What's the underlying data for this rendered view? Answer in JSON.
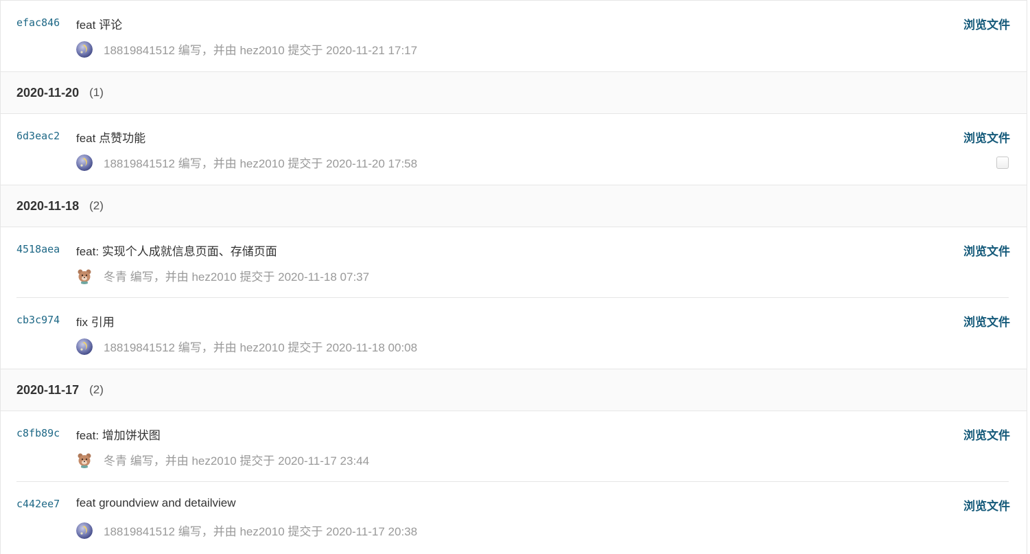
{
  "browse_label": "浏览文件",
  "top_commit": {
    "sha": "efac846",
    "message": "feat 评论",
    "author": "18819841512",
    "meta": "18819841512 编写，并由 hez2010 提交于 2020-11-21 17:17",
    "avatar": "moon-avatar"
  },
  "groups": [
    {
      "date": "2020-11-20",
      "count": "(1)",
      "commits": [
        {
          "sha": "6d3eac2",
          "message": "feat 点赞功能",
          "meta": "18819841512 编写，并由 hez2010 提交于 2020-11-20 17:58",
          "avatar": "moon-avatar",
          "has_checkbox": true
        }
      ]
    },
    {
      "date": "2020-11-18",
      "count": "(2)",
      "commits": [
        {
          "sha": "4518aea",
          "message": "feat: 实现个人成就信息页面、存储页面",
          "meta": "冬青 编写，并由 hez2010 提交于 2020-11-18 07:37",
          "avatar": "bear-avatar"
        },
        {
          "sha": "cb3c974",
          "message": "fix 引用",
          "meta": "18819841512 编写，并由 hez2010 提交于 2020-11-18 00:08",
          "avatar": "moon-avatar"
        }
      ]
    },
    {
      "date": "2020-11-17",
      "count": "(2)",
      "commits": [
        {
          "sha": "c8fb89c",
          "message": "feat: 增加饼状图",
          "meta": "冬青 编写，并由 hez2010 提交于 2020-11-17 23:44",
          "avatar": "bear-avatar"
        },
        {
          "sha": "c442ee7",
          "message": "feat groundview and detailview",
          "meta": "18819841512 编写，并由 hez2010 提交于 2020-11-17 20:38",
          "avatar": "moon-avatar"
        }
      ]
    }
  ],
  "colors": {
    "sha": "#1e6886",
    "browse": "#155a7a",
    "meta": "#999999",
    "header_bg": "#fafafa",
    "border": "#e6e6e6"
  }
}
